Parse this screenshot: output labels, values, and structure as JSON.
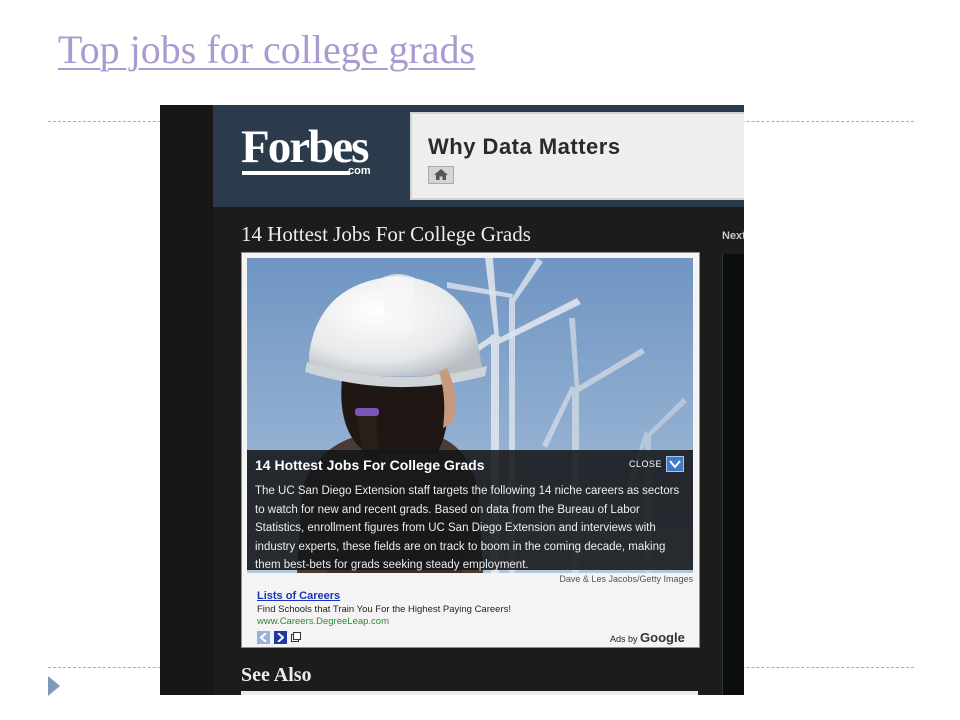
{
  "slide": {
    "title": "Top jobs for college grads"
  },
  "screenshot": {
    "logo": "Forbes",
    "logo_suffix": ".com",
    "banner_text": "Why Data Matters",
    "home_icon": "home-icon",
    "article_title": "14 Hottest Jobs For College Grads",
    "next_label": "Next",
    "gallery": {
      "caption_title": "14 Hottest Jobs For College Grads",
      "close_label": "CLOSE",
      "caption_body": "The UC San Diego Extension staff targets the following 14 niche careers as sectors to watch for new and recent grads. Based on data from the Bureau of Labor Statistics, enrollment figures from UC San Diego Extension and interviews with industry experts, these fields are on track to boom in the coming decade, making them best-bets for grads seeking steady employment.",
      "photo_credit": "Dave & Les Jacobs/Getty Images"
    },
    "ad": {
      "link": "Lists of Careers",
      "description": "Find Schools that Train You For the Highest Paying Careers!",
      "url": "www.Careers.DegreeLeap.com",
      "ads_by": "Ads by",
      "google": "Google"
    },
    "see_also": "See Also"
  },
  "colors": {
    "title_link": "#a99ad0",
    "header_bg": "#2c3b4c",
    "page_bg": "#1b1d1b",
    "ad_link": "#1a33bb",
    "ad_url": "#2e8a2e"
  }
}
